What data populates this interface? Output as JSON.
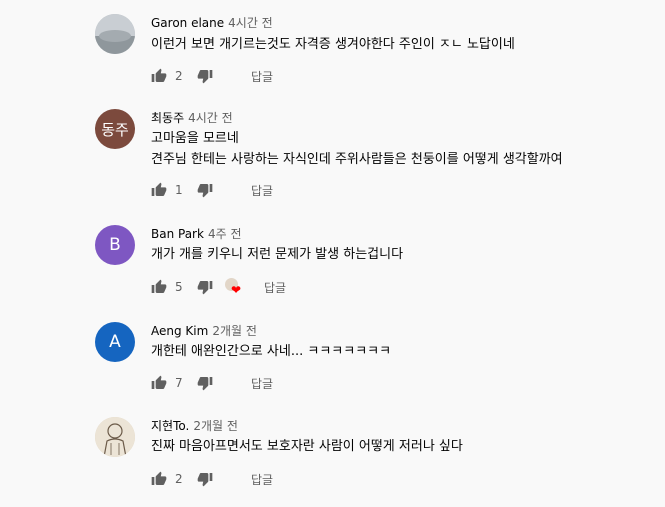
{
  "comments": [
    {
      "author": "Garon elane",
      "time": "4시간 전",
      "lines": [
        "이런거 보면 개기르는것도 자격증 생겨야한다 주인이 ㅈㄴ 노답이네"
      ],
      "likes": "2",
      "reply_label": "답글",
      "avatar_text": "",
      "avatar_color": "#b0b6bd"
    },
    {
      "author": "최동주",
      "time": "4시간 전",
      "lines": [
        "고마움을 모르네",
        "견주님 한테는 사랑하는 자식인데 주위사람들은 천둥이를 어떻게 생각할까여"
      ],
      "likes": "1",
      "reply_label": "답글",
      "avatar_text": "동주",
      "avatar_color": "#7c4a3d"
    },
    {
      "author": "Ban Park",
      "time": "4주 전",
      "lines": [
        "개가 개를 키우니 저런 문제가 발생 하는겁니다"
      ],
      "likes": "5",
      "reply_label": "답글",
      "avatar_text": "B",
      "avatar_color": "#7e57c2"
    },
    {
      "author": "Aeng Kim",
      "time": "2개월 전",
      "lines": [
        "개한테 애완인간으로 사네... ㅋㅋㅋㅋㅋㅋㅋ"
      ],
      "likes": "7",
      "reply_label": "답글",
      "avatar_text": "A",
      "avatar_color": "#1565c0"
    },
    {
      "author": "지현To.",
      "time": "2개월 전",
      "lines": [
        "진짜 마음아프면서도 보호자란 사람이 어떻게 저러나 싶다"
      ],
      "likes": "2",
      "reply_label": "답글",
      "avatar_text": "",
      "avatar_color": "#d9cdb8"
    }
  ]
}
